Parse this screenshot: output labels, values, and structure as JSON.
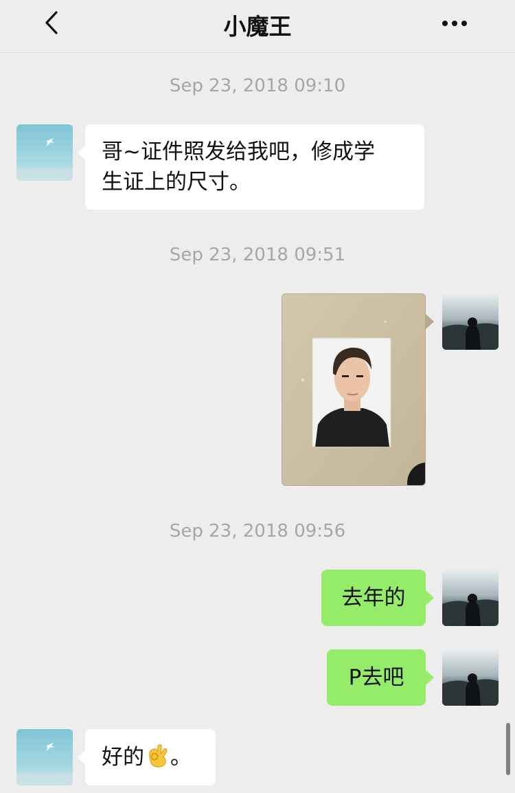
{
  "header": {
    "title": "小魔王",
    "back_icon": "chevron-left-icon",
    "more_icon": "ellipsis-icon"
  },
  "messages": {
    "ts1": "Sep 23, 2018 09:10",
    "m1_line1": "哥~证件照发给我吧，修成学",
    "m1_line2": "生证上的尺寸。",
    "ts2": "Sep 23, 2018 09:51",
    "ts3": "Sep 23, 2018 09:56",
    "m3": "去年的",
    "m4": "P去吧",
    "m5_text": "好的",
    "m5_emoji": "ok-hand-emoji",
    "m5_end": "。"
  },
  "colors": {
    "background": "#ededed",
    "incoming_bubble": "#ffffff",
    "outgoing_bubble": "#95ec69",
    "timestamp": "#a6a6a6"
  }
}
